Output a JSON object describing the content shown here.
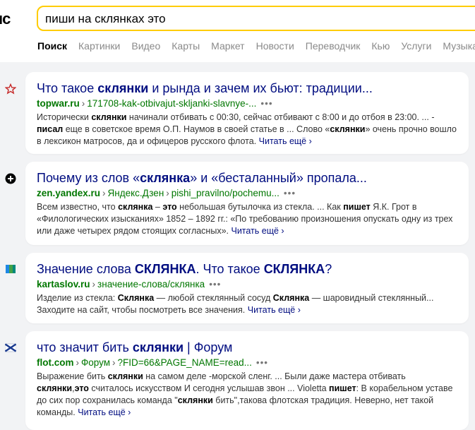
{
  "header": {
    "logo_text": "ıс",
    "search_value": "пиши на склянках это"
  },
  "tabs": [
    {
      "label": "Поиск",
      "active": true
    },
    {
      "label": "Картинки"
    },
    {
      "label": "Видео"
    },
    {
      "label": "Карты"
    },
    {
      "label": "Маркет"
    },
    {
      "label": "Новости"
    },
    {
      "label": "Переводчик"
    },
    {
      "label": "Кью"
    },
    {
      "label": "Услуги"
    },
    {
      "label": "Музыка"
    }
  ],
  "results": [
    {
      "favicon": "star-icon",
      "title": [
        {
          "t": "Что такое "
        },
        {
          "t": "склянки",
          "b": true
        },
        {
          "t": " и рында и зачем их бьют: традиции..."
        }
      ],
      "url": [
        "topwar.ru",
        "171708-kak-otbivajut-skljanki-slavnye-..."
      ],
      "snippet": [
        {
          "t": "Исторически "
        },
        {
          "t": "склянки",
          "b": true
        },
        {
          "t": " начинали отбивать с 00:30, сейчас отбивают с 8:00 и до отбоя в 23:00. ... - "
        },
        {
          "t": "писал",
          "b": true
        },
        {
          "t": " еще в советское время О.П. Наумов в своей статье в ... Слово «"
        },
        {
          "t": "склянки",
          "b": true
        },
        {
          "t": "» очень прочно вошло в лексикон матросов, да и офицеров русского флота. "
        }
      ],
      "more": "Читать ещё ›"
    },
    {
      "favicon": "plus-circle-icon",
      "title": [
        {
          "t": "Почему из слов «"
        },
        {
          "t": "склянка",
          "b": true
        },
        {
          "t": "» и «бесталанный» пропала..."
        }
      ],
      "url": [
        "zen.yandex.ru",
        "Яндекс.Дзен",
        "pishi_pravilno/pochemu..."
      ],
      "snippet": [
        {
          "t": "Всем известно, что "
        },
        {
          "t": "склянка",
          "b": true
        },
        {
          "t": " – "
        },
        {
          "t": "это",
          "b": true
        },
        {
          "t": " небольшая бутылочка из стекла. ... Как "
        },
        {
          "t": "пишет",
          "b": true
        },
        {
          "t": " Я.К. Грот в «Филологических изысканиях» 1852 – 1892 гг.: «По требованию произношения опускать одну из трех или даже четырех рядом стоящих согласных». "
        }
      ],
      "more": "Читать ещё ›"
    },
    {
      "favicon": "book-icon",
      "title": [
        {
          "t": "Значение слова "
        },
        {
          "t": "СКЛЯНКА",
          "b": true
        },
        {
          "t": ". Что такое "
        },
        {
          "t": "СКЛЯНКА",
          "b": true
        },
        {
          "t": "?"
        }
      ],
      "url": [
        "kartaslov.ru",
        "значение-слова/склянка"
      ],
      "snippet": [
        {
          "t": "Изделие из стекла: "
        },
        {
          "t": "Склянка",
          "b": true
        },
        {
          "t": " — любой стеклянный сосуд "
        },
        {
          "t": "Склянка",
          "b": true
        },
        {
          "t": " — шаровидный стеклянный... Заходите на сайт, чтобы посмотреть все значения. "
        }
      ],
      "more": "Читать ещё ›"
    },
    {
      "favicon": "flag-icon",
      "title": [
        {
          "t": "что значит бить "
        },
        {
          "t": "склянки",
          "b": true
        },
        {
          "t": " | Форум"
        }
      ],
      "url": [
        "flot.com",
        "Форум",
        "?FID=66&PAGE_NAME=read..."
      ],
      "snippet": [
        {
          "t": "Выражение бить "
        },
        {
          "t": "склянки",
          "b": true
        },
        {
          "t": " на самом деле -морской сленг. ... Были даже мастера отбивать "
        },
        {
          "t": "склянки",
          "b": true
        },
        {
          "t": ","
        },
        {
          "t": "это",
          "b": true
        },
        {
          "t": " считалось искусством И сегодня услышав звон ... Violetta "
        },
        {
          "t": "пишет",
          "b": true
        },
        {
          "t": ": В корабельном уставе до сих пор сохранилась команда \""
        },
        {
          "t": "склянки",
          "b": true
        },
        {
          "t": " бить\",такова флотская традиция. Неверно, нет такой команды. "
        }
      ],
      "more": "Читать ещё ›"
    }
  ],
  "colors": {
    "search_border": "#ffcc00",
    "title": "#000d80",
    "url": "#007700"
  }
}
